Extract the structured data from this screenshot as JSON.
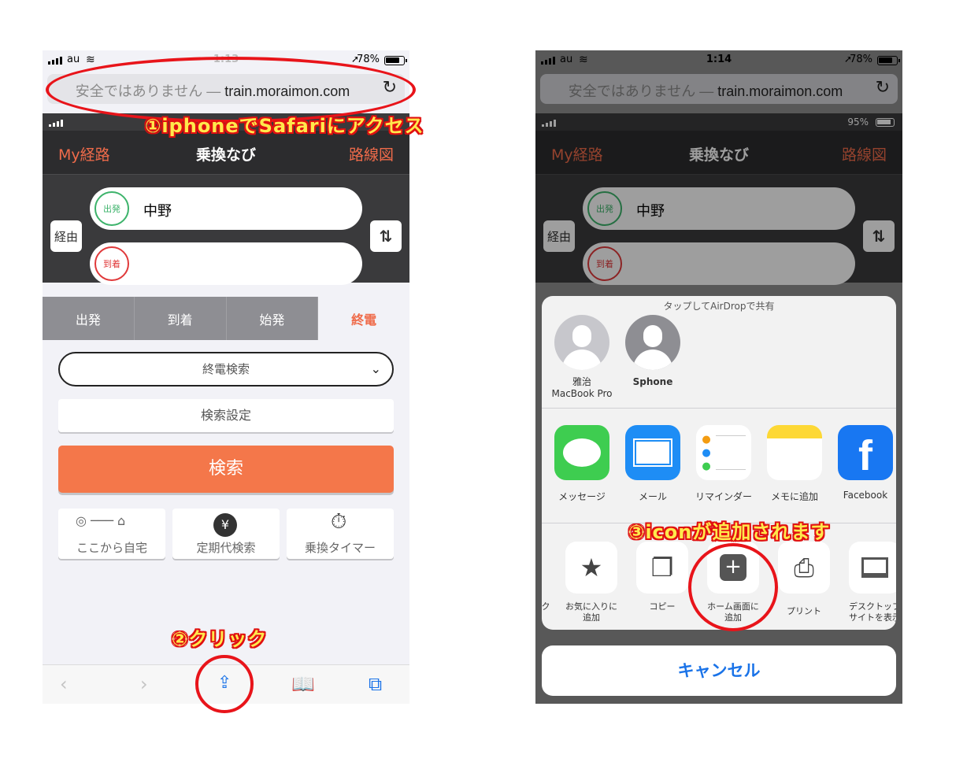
{
  "left": {
    "status": {
      "carrier": "au",
      "time": "1:13",
      "battery": "78%"
    },
    "address": {
      "insecure_label": "安全ではありません —",
      "domain": "train.moraimon.com"
    },
    "app_status": {
      "battery": ""
    },
    "nav": {
      "myroute": "My経路",
      "title": "乗換なび",
      "map": "路線図"
    },
    "route": {
      "depart_badge": "出発",
      "depart_value": "中野",
      "arrive_badge": "到着",
      "arrive_value": "",
      "via": "経由",
      "swap_icon": "swap-icon"
    },
    "tabs": [
      "出発",
      "到着",
      "始発",
      "終電"
    ],
    "active_tab": 3,
    "search_mode": "終電検索",
    "search_settings": "検索設定",
    "search_button": "検索",
    "tiles": [
      "ここから自宅",
      "定期代検索",
      "乗換タイマー"
    ],
    "toolbar_icons": [
      "back-icon",
      "forward-icon",
      "share-icon",
      "bookmarks-icon",
      "tabs-icon"
    ]
  },
  "right": {
    "status": {
      "carrier": "au",
      "time": "1:14",
      "battery": "78%"
    },
    "address": {
      "insecure_label": "安全ではありません —",
      "domain": "train.moraimon.com"
    },
    "app_status": {
      "battery": "95%"
    },
    "nav": {
      "myroute": "My経路",
      "title": "乗換なび",
      "map": "路線図"
    },
    "route": {
      "depart_badge": "出発",
      "depart_value": "中野",
      "arrive_badge": "到着",
      "via": "経由"
    },
    "sheet": {
      "airdrop_header": "タップしてAirDropで共有",
      "devices": [
        {
          "name": "雅治",
          "sub": "MacBook Pro"
        },
        {
          "name": "Sphone",
          "sub": ""
        }
      ],
      "apps": [
        "メッセージ",
        "メール",
        "リマインダー",
        "メモに追加",
        "Facebook"
      ],
      "actions": [
        {
          "label": "お気に入りに\n追加",
          "icon": "star-icon"
        },
        {
          "label": "コピー",
          "icon": "copy-icon"
        },
        {
          "label": "ホーム画面に\n追加",
          "icon": "add-to-home-icon"
        },
        {
          "label": "プリント",
          "icon": "print-icon"
        },
        {
          "label": "デスクトップ\nサイトを表示",
          "icon": "desktop-icon"
        }
      ],
      "cancel": "キャンセル"
    }
  },
  "annotations": {
    "step1": "①iphoneでSafariにアクセス",
    "step2": "②クリック",
    "step3": "③iconが追加されます"
  },
  "colors": {
    "accent": "#ef6b4a",
    "search": "#f4774a",
    "annotation": "#e8141a",
    "annotation_text": "#ffe94c",
    "ios_blue": "#1a73e8"
  }
}
